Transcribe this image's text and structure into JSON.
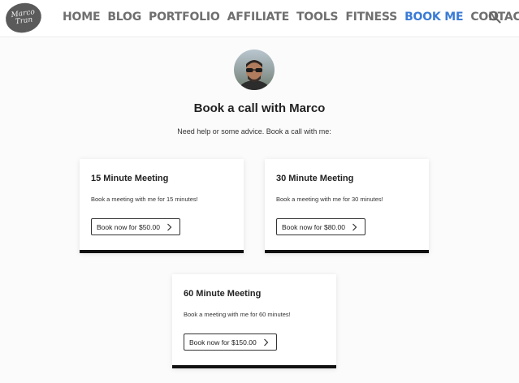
{
  "logo": {
    "line1": "Marco",
    "line2": "Tran"
  },
  "nav": {
    "items": [
      {
        "label": "HOME"
      },
      {
        "label": "BLOG"
      },
      {
        "label": "PORTFOLIO"
      },
      {
        "label": "AFFILIATE"
      },
      {
        "label": "TOOLS"
      },
      {
        "label": "FITNESS"
      },
      {
        "label": "BOOK ME",
        "active": true
      },
      {
        "label": "CONTACT"
      }
    ],
    "active_color": "#3a7bd5",
    "search_icon": "search-icon"
  },
  "page": {
    "title": "Book a call with Marco",
    "subtitle": "Need help or some advice. Book a call with me:"
  },
  "cards": [
    {
      "title": "15 Minute Meeting",
      "desc": "Book a meeting with me for 15 minutes!",
      "button": "Book now for $50.00"
    },
    {
      "title": "30 Minute Meeting",
      "desc": "Book a meeting with me for 30 minutes!",
      "button": "Book now for $80.00"
    },
    {
      "title": "60 Minute Meeting",
      "desc": "Book a meeting with me for 60 minutes!",
      "button": "Book now for $150.00"
    }
  ]
}
